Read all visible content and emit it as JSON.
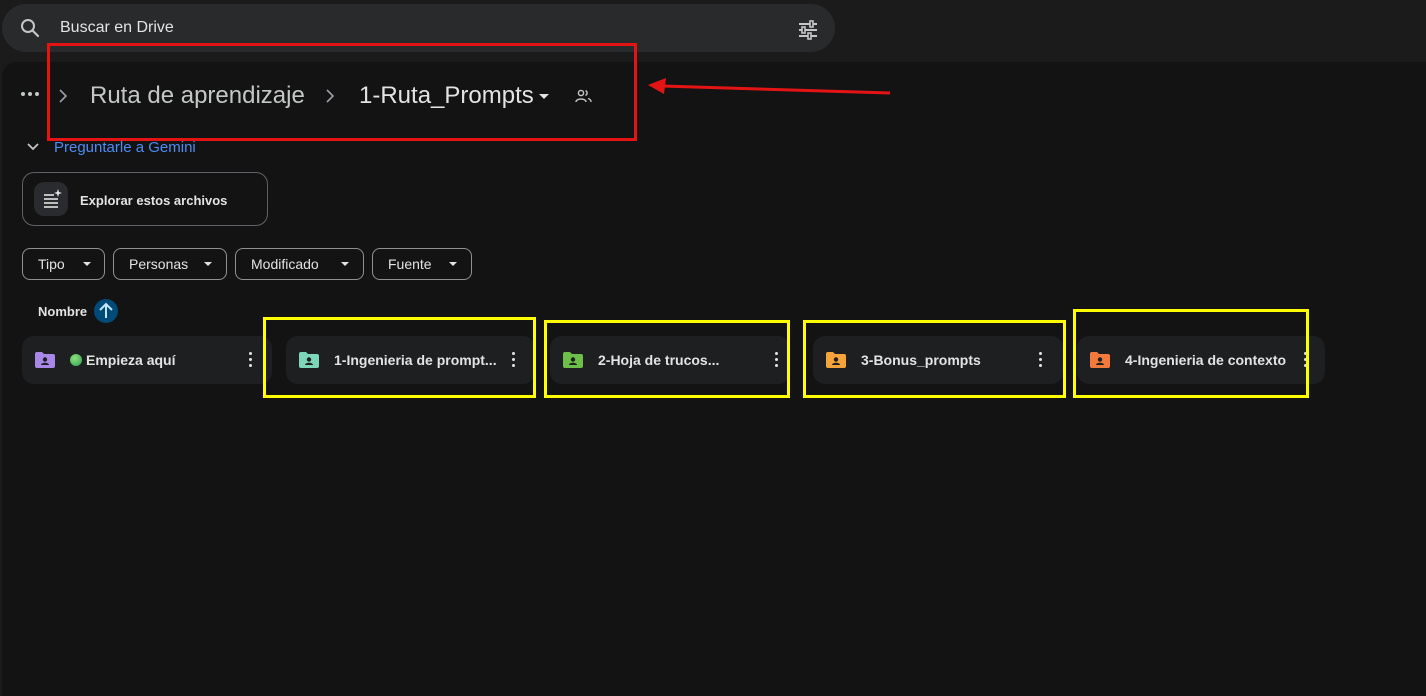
{
  "search": {
    "placeholder": "Buscar en Drive"
  },
  "breadcrumb": {
    "items": [
      "Ruta de aprendizaje",
      "1-Ruta_Prompts"
    ]
  },
  "gemini": {
    "label": "Preguntarle a Gemini"
  },
  "explore": {
    "label": "Explorar estos archivos"
  },
  "filters": [
    "Tipo",
    "Personas",
    "Modificado",
    "Fuente"
  ],
  "sort": {
    "label": "Nombre"
  },
  "folders": [
    {
      "name": "Empieza aquí",
      "color": "#a987e8"
    },
    {
      "name": "1-Ingenieria de prompt...",
      "color": "#7ed6b8"
    },
    {
      "name": "2-Hoja de trucos...",
      "color": "#6cc04a"
    },
    {
      "name": "3-Bonus_prompts",
      "color": "#f6a33b"
    },
    {
      "name": "4-Ingenieria de contexto",
      "color": "#f37a3c"
    }
  ],
  "annotation_colors": {
    "red": "#e51414",
    "yellow": "#ffff00"
  }
}
